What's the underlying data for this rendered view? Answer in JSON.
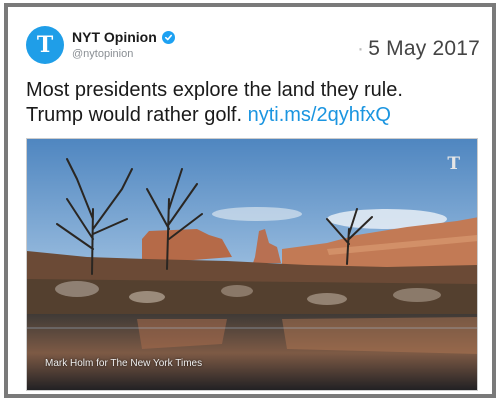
{
  "account": {
    "name": "NYT Opinion",
    "handle": "@nytopinion",
    "avatar_glyph": "T",
    "verified": true,
    "brand_color": "#1f9ee8"
  },
  "date": "5 May 2017",
  "tweet": {
    "text_line1": "Most presidents explore the land they rule.",
    "text_line2_prefix": "Trump would rather golf.",
    "link": "nyti.ms/2qyhfxQ",
    "link_color": "#1b95e0"
  },
  "media": {
    "credit": "Mark Holm for The New York Times",
    "watermark_glyph": "T"
  }
}
